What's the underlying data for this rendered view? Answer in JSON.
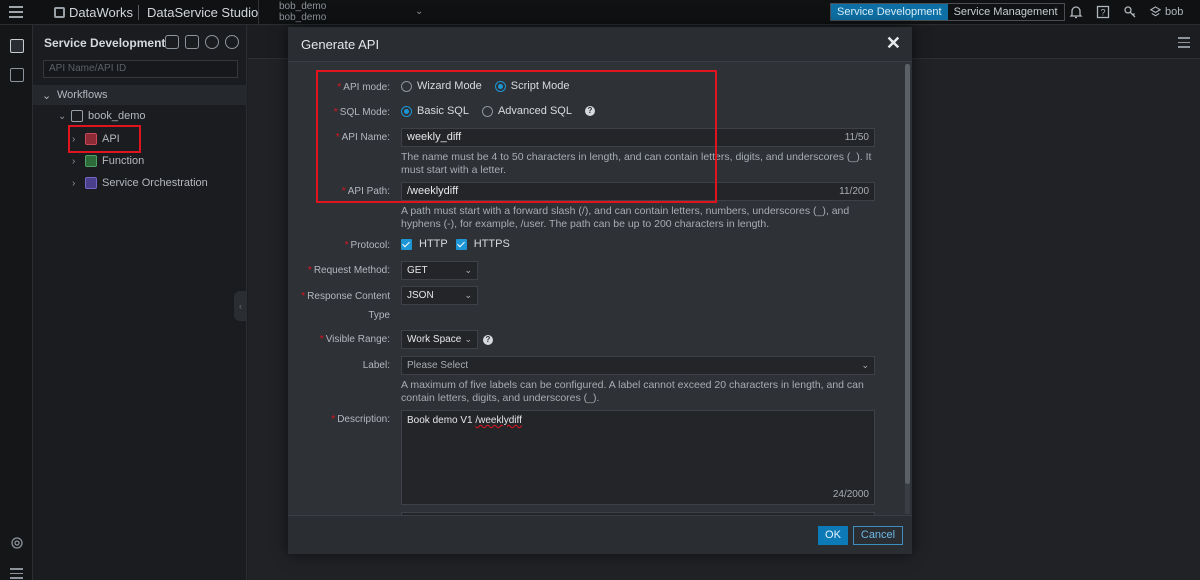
{
  "topbar": {
    "brand": "DataWorks",
    "studio": "DataService Studio",
    "workspace_line1": "bob_demo",
    "workspace_line2": "bob_demo",
    "tab_dev": "Service Development",
    "tab_mgmt": "Service Management",
    "user": "bob"
  },
  "sidebar": {
    "title": "Service Development",
    "search_placeholder": "API Name/API ID",
    "section": "Workflows",
    "tree": {
      "root": "book_demo",
      "api": "API",
      "function": "Function",
      "orchestration": "Service Orchestration"
    }
  },
  "dialog": {
    "title": "Generate API",
    "close": "✕",
    "api_mode": {
      "label": "API mode:",
      "options": [
        "Wizard Mode",
        "Script Mode"
      ],
      "selected": "Script Mode"
    },
    "sql_mode": {
      "label": "SQL Mode:",
      "options": [
        "Basic SQL",
        "Advanced SQL"
      ],
      "selected": "Basic SQL"
    },
    "api_name": {
      "label": "API Name:",
      "value": "weekly_diff",
      "counter": "11/50",
      "hint": "The name must be 4 to 50 characters in length, and can contain letters, digits, and underscores (_). It must start with a letter."
    },
    "api_path": {
      "label": "API Path:",
      "value": "/weeklydiff",
      "counter": "11/200",
      "hint": "A path must start with a forward slash (/), and can contain letters, numbers, underscores (_), and hyphens (-), for example, /user. The path can be up to 200 characters in length."
    },
    "protocol": {
      "label": "Protocol:",
      "options": [
        "HTTP",
        "HTTPS"
      ]
    },
    "request_method": {
      "label": "Request Method:",
      "value": "GET"
    },
    "response_type": {
      "label_line1": "Response Content",
      "label_line2": "Type",
      "value": "JSON"
    },
    "visible_range": {
      "label": "Visible Range:",
      "value": "Work Space"
    },
    "label_field": {
      "label": "Label:",
      "placeholder": "Please Select",
      "hint": "A maximum of five labels can be configured. A label cannot exceed 20 characters in length, and can contain letters, digits, and underscores (_)."
    },
    "description": {
      "label": "Description:",
      "value_prefix": "Book demo V1 ",
      "value_path": "/weeklydiff",
      "counter": "24/2000"
    },
    "ok": "OK",
    "cancel": "Cancel"
  },
  "colors": {
    "accent": "#1d96d6",
    "highlight_box": "#e0141e",
    "required": "#e0141e",
    "mode_tab_active": "#0d6fa3"
  },
  "icons": [
    "menu-icon",
    "bell-icon",
    "help-icon",
    "key-icon",
    "user-icon",
    "workflow-icon",
    "list-icon",
    "settings-icon",
    "chevron-down-icon",
    "close-icon"
  ]
}
